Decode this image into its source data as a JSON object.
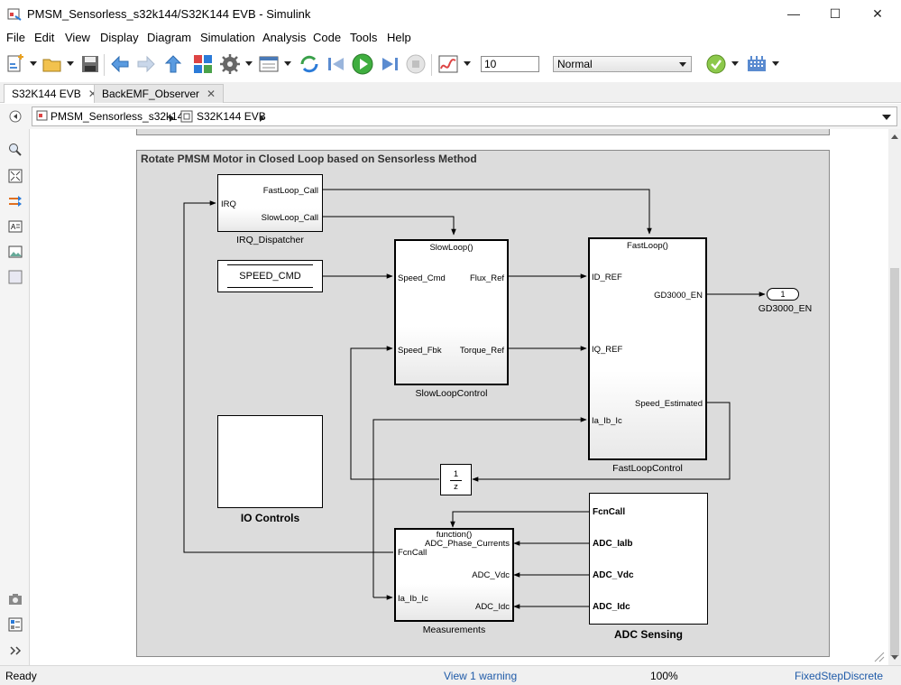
{
  "window": {
    "title": "PMSM_Sensorless_s32k144/S32K144 EVB - Simulink",
    "minimize": "—",
    "maximize": "☐",
    "close": "✕"
  },
  "menu": [
    "File",
    "Edit",
    "View",
    "Display",
    "Diagram",
    "Simulation",
    "Analysis",
    "Code",
    "Tools",
    "Help"
  ],
  "toolbar": {
    "stop_time": "10",
    "sim_mode": "Normal"
  },
  "tabs": [
    {
      "label": "S32K144 EVB",
      "close": "✕"
    },
    {
      "label": "BackEMF_Observer",
      "close": "✕"
    }
  ],
  "breadcrumb": [
    "PMSM_Sensorless_s32k144",
    "S32K144 EVB"
  ],
  "diagram": {
    "area_title": "Rotate PMSM Motor in Closed Loop based on Sensorless Method",
    "irq": {
      "name": "IRQ_Dispatcher",
      "in": "IRQ",
      "out1": "FastLoop_Call",
      "out2": "SlowLoop_Call"
    },
    "speed_cmd": {
      "label": "SPEED_CMD"
    },
    "slow": {
      "name": "SlowLoopControl",
      "trigger": "SlowLoop()",
      "in1": "Speed_Cmd",
      "in2": "Speed_Fbk",
      "out1": "Flux_Ref",
      "out2": "Torque_Ref"
    },
    "fast": {
      "name": "FastLoopControl",
      "trigger": "FastLoop()",
      "in1": "ID_REF",
      "in2": "IQ_REF",
      "in3": "Ia_Ib_Ic",
      "out1": "GD3000_EN",
      "out2": "Speed_Estimated"
    },
    "outport": {
      "number": "1",
      "name": "GD3000_EN"
    },
    "delay": {
      "num": "1",
      "den": "z"
    },
    "io": {
      "name": "IO Controls"
    },
    "meas": {
      "name": "Measurements",
      "trigger": "function()",
      "in1": "FcnCall",
      "in2": "Ia_Ib_Ic",
      "out1": "ADC_Phase_Currents",
      "out2": "ADC_Vdc",
      "out3": "ADC_Idc"
    },
    "adc": {
      "name": "ADC Sensing",
      "p1": "FcnCall",
      "p2": "ADC_Ialb",
      "p3": "ADC_Vdc",
      "p4": "ADC_Idc"
    }
  },
  "status": {
    "left": "Ready",
    "warning": "View 1 warning",
    "zoom": "100%",
    "solver": "FixedStepDiscrete"
  }
}
